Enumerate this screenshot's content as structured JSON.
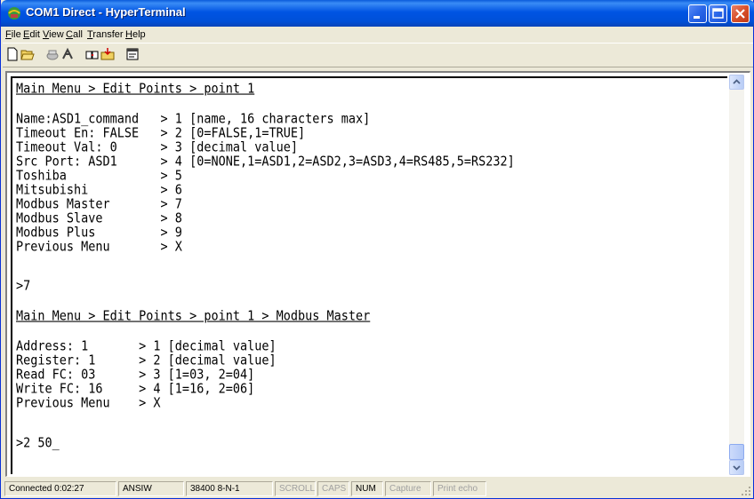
{
  "window": {
    "title": "COM1 Direct - HyperTerminal"
  },
  "menu": [
    {
      "accel": "F",
      "rest": "ile"
    },
    {
      "accel": "E",
      "rest": "dit"
    },
    {
      "accel": "V",
      "rest": "iew"
    },
    {
      "accel": "C",
      "rest": "all"
    },
    {
      "accel": "T",
      "rest": "ransfer"
    },
    {
      "accel": "H",
      "rest": "elp"
    }
  ],
  "toolbar": {
    "icons": [
      "new-connection-icon",
      "open-icon",
      "connect-icon",
      "disconnect-icon",
      "send-icon",
      "receive-icon",
      "properties-icon"
    ]
  },
  "terminal": {
    "lines": [
      "Main Menu > Edit Points > point 1",
      "",
      "Name:ASD1_command   > 1 [name, 16 characters max]",
      "Timeout En: FALSE   > 2 [0=FALSE,1=TRUE]",
      "Timeout Val: 0      > 3 [decimal value]",
      "Src Port: ASD1      > 4 [0=NONE,1=ASD1,2=ASD2,3=ASD3,4=RS485,5=RS232]",
      "Toshiba             > 5",
      "Mitsubishi          > 6",
      "Modbus Master       > 7",
      "Modbus Slave        > 8",
      "Modbus Plus         > 9",
      "Previous Menu       > X",
      "",
      ">7",
      "",
      "Main Menu > Edit Points > point 1 > Modbus Master",
      "",
      "Address: 1       > 1 [decimal value]",
      "Register: 1      > 2 [decimal value]",
      "Read FC: 03      > 3 [1=03, 2=04]",
      "Write FC: 16     > 4 [1=16, 2=06]",
      "Previous Menu    > X",
      "",
      ">2 50_"
    ]
  },
  "status": {
    "connected": "Connected 0:02:27",
    "emulation": "ANSIW",
    "settings": "38400 8-N-1",
    "scroll": "SCROLL",
    "caps": "CAPS",
    "num": "NUM",
    "capture": "Capture",
    "print_echo": "Print echo"
  }
}
